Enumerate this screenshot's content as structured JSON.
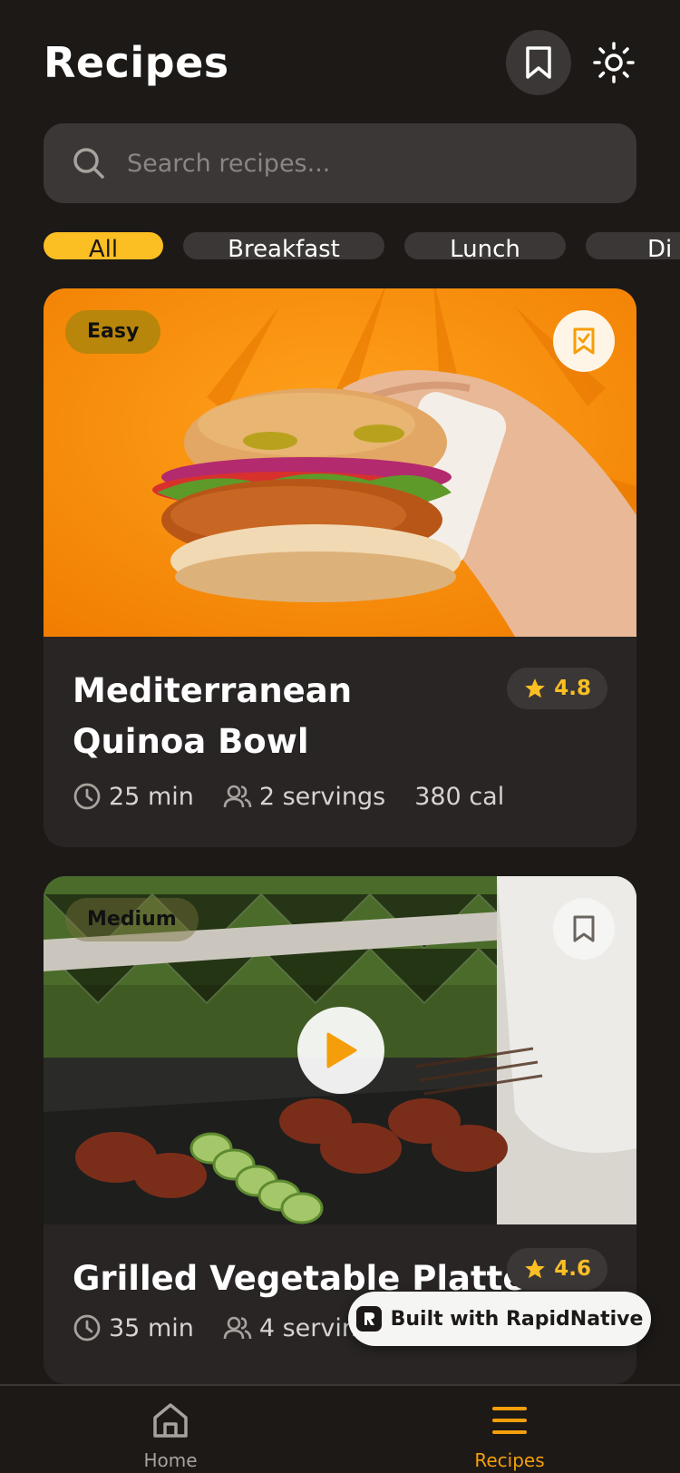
{
  "header": {
    "title": "Recipes"
  },
  "search": {
    "placeholder": "Search recipes..."
  },
  "categories": [
    "All",
    "Breakfast",
    "Lunch",
    "Di"
  ],
  "recipes": [
    {
      "difficulty": "Easy",
      "title": "Mediterranean Quinoa Bowl",
      "rating": "4.8",
      "time": "25 min",
      "servings": "2 servings",
      "calories": "380 cal",
      "saved": true
    },
    {
      "difficulty": "Medium",
      "title": "Grilled Vegetable Platter",
      "rating": "4.6",
      "time": "35 min",
      "servings": "4 servings",
      "saved": false
    }
  ],
  "badge": {
    "label": "Built with RapidNative"
  },
  "nav": {
    "home": "Home",
    "recipes": "Recipes"
  },
  "colors": {
    "accent": "#fbbf24",
    "background": "#1c1917",
    "surface": "#282524"
  },
  "icons": [
    "bookmark-icon",
    "sun-icon",
    "search-icon",
    "clock-icon",
    "users-icon",
    "star-icon",
    "play-icon",
    "home-icon",
    "menu-icon"
  ]
}
